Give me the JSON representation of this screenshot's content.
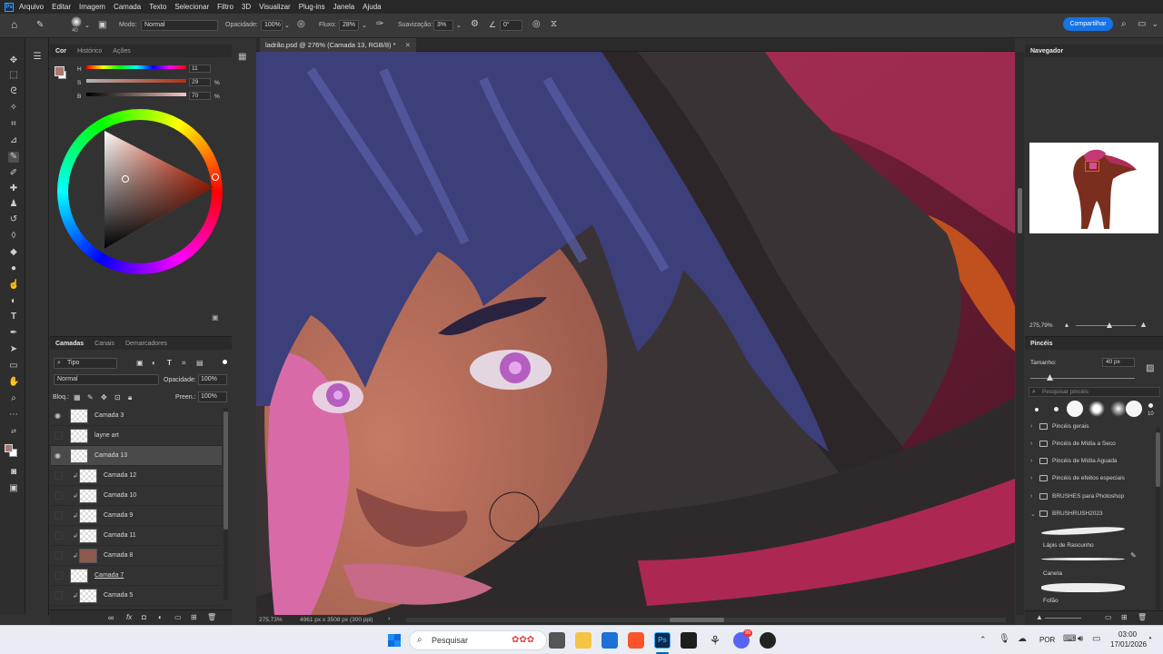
{
  "app": {
    "badge": "Ps"
  },
  "menu": [
    "Arquivo",
    "Editar",
    "Imagem",
    "Camada",
    "Texto",
    "Selecionar",
    "Filtro",
    "3D",
    "Visualizar",
    "Plug-ins",
    "Janela",
    "Ajuda"
  ],
  "options": {
    "brush_size": "40",
    "mode_label": "Modo:",
    "mode_value": "Normal",
    "opacity_label": "Opacidade:",
    "opacity_value": "100%",
    "flow_label": "Fluxo:",
    "flow_value": "28%",
    "smoothing_label": "Suavização:",
    "smoothing_value": "3%",
    "angle_value": "0°",
    "share_label": "Compartilhar"
  },
  "color_panel": {
    "tabs": [
      "Cor",
      "Histórico",
      "Ações"
    ],
    "h_label": "H",
    "h_value": "11",
    "h_unit": "",
    "s_label": "S",
    "s_value": "29",
    "s_unit": "%",
    "b_label": "B",
    "b_value": "70",
    "b_unit": "%",
    "fg_color": "#a9786f",
    "bg_color": "#ffffff"
  },
  "document": {
    "tab_title": "ladrão.psd @ 276% (Camada 13, RGB/8) *",
    "zoom": "275,73%",
    "dimensions": "4961 px x 3508 px (300 ppi)"
  },
  "layers_panel": {
    "tabs": [
      "Camadas",
      "Canais",
      "Demarcadores"
    ],
    "filter_value": "Tipo",
    "blend_mode": "Normal",
    "opacity_label": "Opacidade:",
    "opacity_value": "100%",
    "lock_label": "Bloq.:",
    "fill_label": "Preen.:",
    "fill_value": "100%",
    "layers": [
      {
        "name": "Camada 3",
        "visible": true,
        "clipped": false
      },
      {
        "name": "layne art",
        "visible": false,
        "clipped": false
      },
      {
        "name": "Camada 13",
        "visible": true,
        "clipped": false,
        "selected": true
      },
      {
        "name": "Camada 12",
        "visible": false,
        "clipped": true
      },
      {
        "name": "Camada 10",
        "visible": false,
        "clipped": true
      },
      {
        "name": "Camada 9",
        "visible": false,
        "clipped": true
      },
      {
        "name": "Camada 11",
        "visible": false,
        "clipped": true
      },
      {
        "name": "Camada 8",
        "visible": false,
        "clipped": true
      },
      {
        "name": "Camada 7",
        "visible": false,
        "clipped": false
      },
      {
        "name": "Camada 5",
        "visible": false,
        "clipped": true
      }
    ]
  },
  "navigator": {
    "title": "Navegador",
    "zoom": "275,79%"
  },
  "brushes_panel": {
    "title": "Pincéis",
    "size_label": "Tamanho:",
    "size_value": "40 px",
    "search_placeholder": "Pesquisar pincéis",
    "preset_count": "10",
    "folders": [
      "Pincéis gerais",
      "Pincéis de Mídia a Seco",
      "Pincéis de Mídia Aguada",
      "Pincéis de efeitos especiais",
      "BRUSHES para Photoshop",
      "BRUSHRUSH2023"
    ],
    "brushes": [
      "Lápis de Rascunho",
      "Caneta",
      "Fofão"
    ]
  },
  "taskbar": {
    "search_placeholder": "Pesquisar",
    "language": "POR",
    "time": "03:00",
    "date": "17/01/2026",
    "discord_badge": "99"
  }
}
